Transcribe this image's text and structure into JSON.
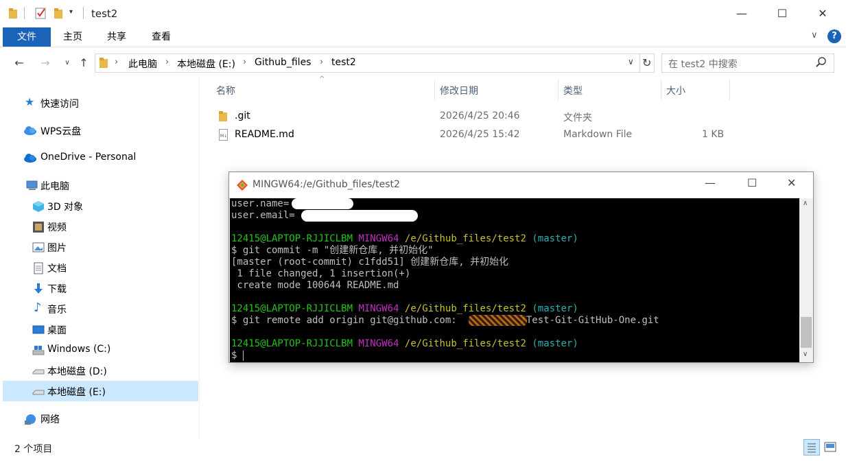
{
  "window": {
    "title": "test2",
    "minimize": "—",
    "maximize": "☐",
    "close": "✕"
  },
  "ribbon": {
    "tabs": [
      "文件",
      "主页",
      "共享",
      "查看"
    ],
    "help": "?"
  },
  "address": {
    "crumbs": [
      "此电脑",
      "本地磁盘 (E:)",
      "Github_files",
      "test2"
    ],
    "search_placeholder": "在 test2 中搜索"
  },
  "sidebar": {
    "items": [
      {
        "label": "快速访问",
        "icon": "star-icon"
      },
      {
        "label": "WPS云盘",
        "icon": "cloud-icon"
      },
      {
        "label": "OneDrive - Personal",
        "icon": "onedrive-cloud-icon"
      },
      {
        "label": "此电脑",
        "icon": "computer-icon"
      },
      {
        "label": "3D 对象",
        "icon": "cube-icon"
      },
      {
        "label": "视频",
        "icon": "film-icon"
      },
      {
        "label": "图片",
        "icon": "picture-icon"
      },
      {
        "label": "文档",
        "icon": "document-icon"
      },
      {
        "label": "下载",
        "icon": "download-arrow-icon"
      },
      {
        "label": "音乐",
        "icon": "music-note-icon"
      },
      {
        "label": "桌面",
        "icon": "desktop-icon"
      },
      {
        "label": "Windows (C:)",
        "icon": "windows-drive-icon"
      },
      {
        "label": "本地磁盘 (D:)",
        "icon": "drive-icon"
      },
      {
        "label": "本地磁盘 (E:)",
        "icon": "drive-icon"
      },
      {
        "label": "网络",
        "icon": "network-icon"
      }
    ],
    "selected": "本地磁盘 (E:)"
  },
  "filelist": {
    "columns": [
      "名称",
      "修改日期",
      "类型",
      "大小"
    ],
    "rows": [
      {
        "name": ".git",
        "modified": "2026/4/25 20:46",
        "type": "文件夹",
        "size": "",
        "icon": "folder-icon"
      },
      {
        "name": "README.md",
        "modified": "2026/4/25 15:42",
        "type": "Markdown File",
        "size": "1 KB",
        "icon": "markdown-file-icon"
      }
    ]
  },
  "status": {
    "count": "2 个项目"
  },
  "terminal": {
    "title": "MINGW64:/e/Github_files/test2",
    "lines": [
      {
        "t": "user.name="
      },
      {
        "t": "user.email="
      },
      {
        "t": ""
      },
      {
        "prompt": true,
        "user": "12415@LAPTOP-RJJICLBM",
        "env": "MINGW64",
        "path": "/e/Github_files/test2",
        "branch": "(master)"
      },
      {
        "t": "$ git commit -m \"创建新仓库, 并初始化\""
      },
      {
        "t": "[master (root-commit) c1fdd51] 创建新仓库, 并初始化"
      },
      {
        "t": " 1 file changed, 1 insertion(+)"
      },
      {
        "t": " create mode 100644 README.md"
      },
      {
        "t": ""
      },
      {
        "prompt": true,
        "user": "12415@LAPTOP-RJJICLBM",
        "env": "MINGW64",
        "path": "/e/Github_files/test2",
        "branch": "(master)"
      },
      {
        "t": "$ git remote add origin git@github.com:           /Test-Git-GitHub-One.git"
      },
      {
        "t": ""
      },
      {
        "prompt": true,
        "user": "12415@LAPTOP-RJJICLBM",
        "env": "MINGW64",
        "path": "/e/Github_files/test2",
        "branch": "(master)"
      },
      {
        "t": "$ "
      }
    ]
  },
  "colors": {
    "accent": "#1a63b8",
    "selected": "#cce8ff",
    "header": "#4c607a"
  }
}
